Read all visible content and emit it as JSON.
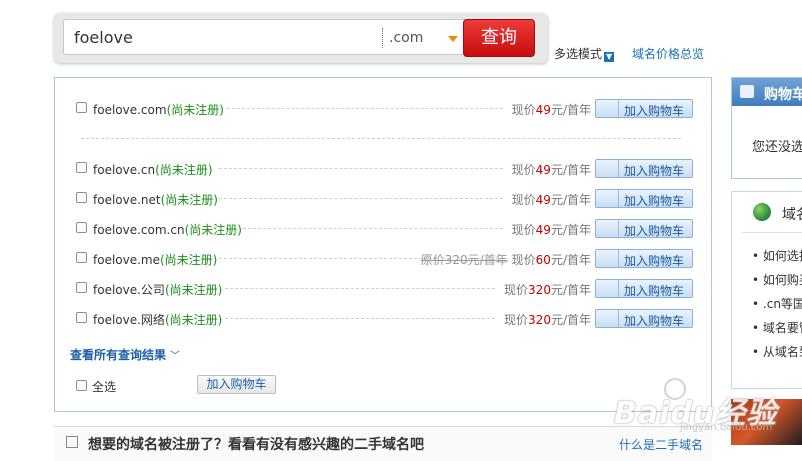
{
  "search": {
    "query": "foelove",
    "tld": ".com",
    "button_label": "查询"
  },
  "header_links": {
    "multi_mode": "多选模式",
    "price_overview": "域名价格总览"
  },
  "results": [
    {
      "domain": "foelove.com",
      "status": "(尚未注册)",
      "price_prefix": "现价",
      "price": "49",
      "price_suffix": "元/首年",
      "old_price": "",
      "add_label": "加入购物车"
    },
    {
      "domain": "foelove.cn",
      "status": "(尚未注册)",
      "price_prefix": "现价",
      "price": "49",
      "price_suffix": "元/首年",
      "old_price": "",
      "add_label": "加入购物车"
    },
    {
      "domain": "foelove.net",
      "status": "(尚未注册)",
      "price_prefix": "现价",
      "price": "49",
      "price_suffix": "元/首年",
      "old_price": "",
      "add_label": "加入购物车"
    },
    {
      "domain": "foelove.com.cn",
      "status": "(尚未注册)",
      "price_prefix": "现价",
      "price": "49",
      "price_suffix": "元/首年",
      "old_price": "",
      "add_label": "加入购物车"
    },
    {
      "domain": "foelove.me",
      "status": "(尚未注册)",
      "price_prefix": "现价",
      "price": "60",
      "price_suffix": "元/首年",
      "old_price": "原价320元/首年",
      "add_label": "加入购物车"
    },
    {
      "domain": "foelove.公司",
      "status": "(尚未注册)",
      "price_prefix": "现价",
      "price": "320",
      "price_suffix": "元/首年",
      "old_price": "",
      "add_label": "加入购物车"
    },
    {
      "domain": "foelove.网络",
      "status": "(尚未注册)",
      "price_prefix": "现价",
      "price": "320",
      "price_suffix": "元/首年",
      "old_price": "",
      "add_label": "加入购物车"
    }
  ],
  "see_all": "查看所有查询结果",
  "select_all": "全选",
  "bulk_add": "加入购物车",
  "cart": {
    "title": "购物车",
    "empty": "您还没选"
  },
  "domain_panel": {
    "title": "域名",
    "items": [
      "如何选择",
      "如何购买",
      ".cn等国",
      "域名要管",
      "从域名到"
    ]
  },
  "bottom": {
    "text": "想要的域名被注册了？看看有没有感兴趣的二手域名吧",
    "link": "什么是二手域名"
  },
  "watermark": {
    "text": "Baidu经验",
    "url": "jingyan.baidu.com"
  },
  "colors": {
    "search_button": "#d81e1e",
    "link_blue": "#1b6fba",
    "status_green": "#1a8f1a",
    "price_red": "#c40000"
  },
  "icons": [
    "cart-icon",
    "globe-icon",
    "dropdown-arrow-icon",
    "chevron-down-icon"
  ]
}
